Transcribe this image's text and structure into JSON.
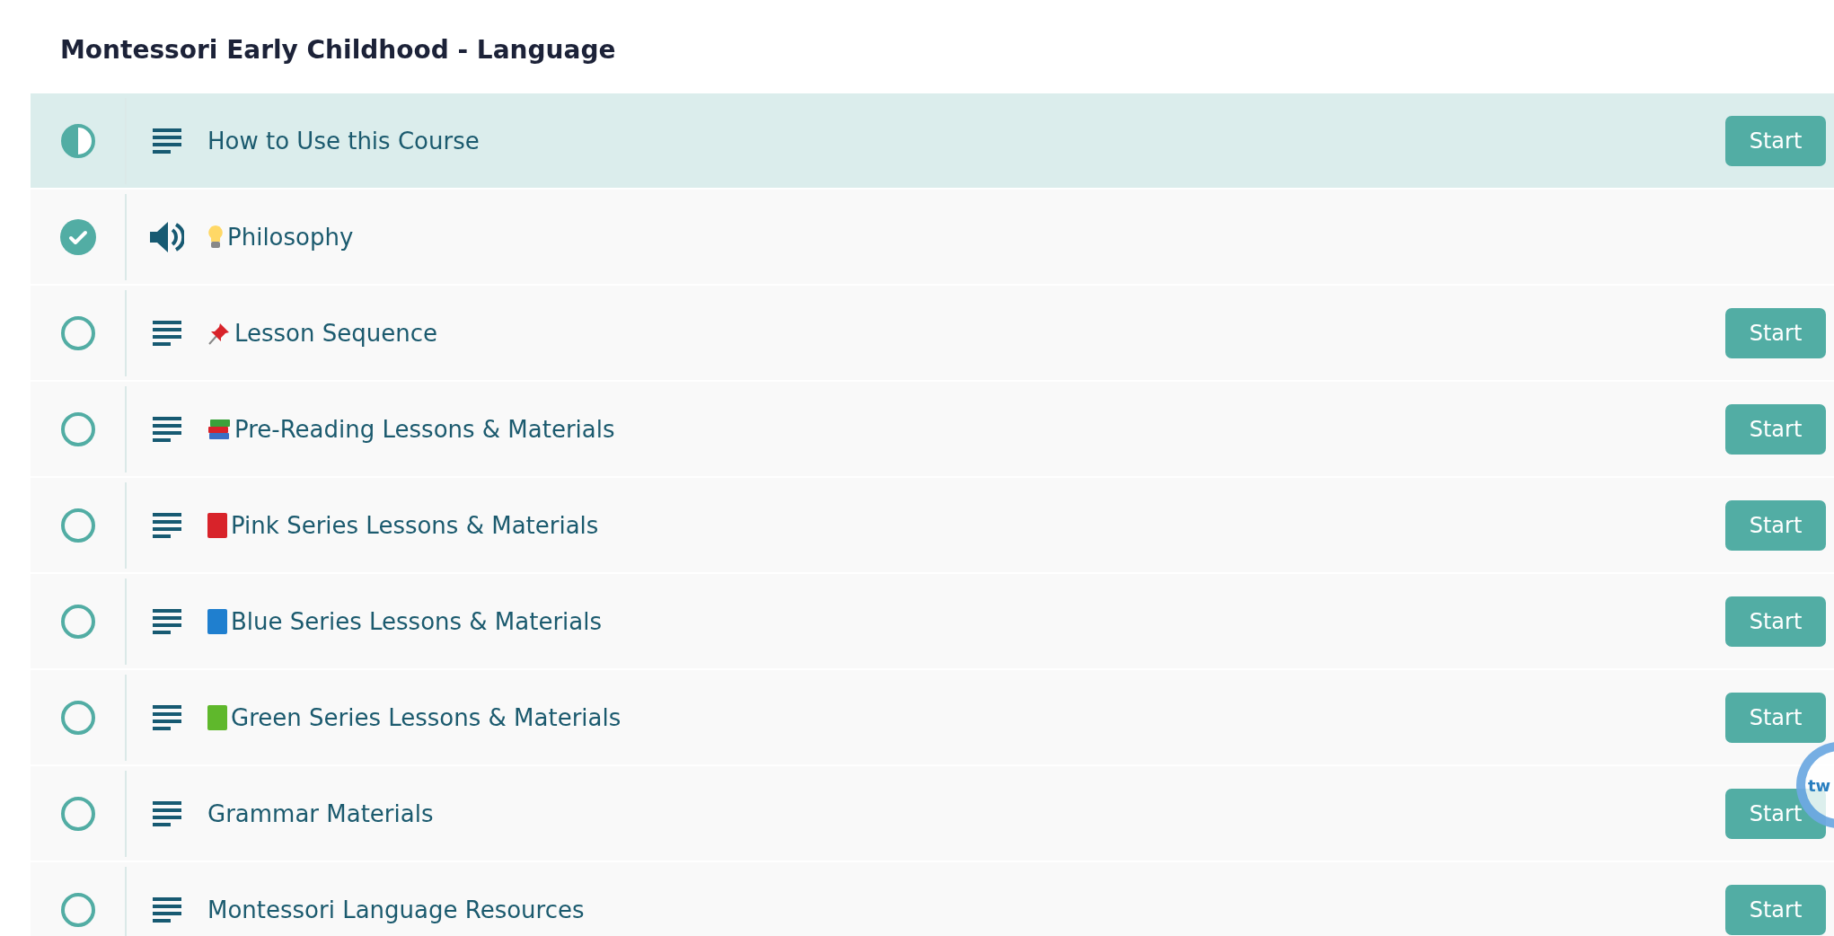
{
  "course_title": "Montessori Early Childhood - Language",
  "lessons": [
    {
      "title": "How to Use this Course",
      "level": 0.5,
      "kind": "text",
      "selected": true,
      "button": "Start"
    },
    {
      "title": "Philosophy",
      "level": 1,
      "kind": "audio",
      "selected": false,
      "emoji": {
        "kind": "bulb"
      }
    },
    {
      "title": "Lesson Sequence",
      "level": 0,
      "kind": "text",
      "selected": false,
      "emoji": {
        "kind": "pin"
      },
      "button": "Start"
    },
    {
      "title": "Pre-Reading Lessons & Materials",
      "level": 0,
      "kind": "text",
      "selected": false,
      "emoji": {
        "kind": "books"
      },
      "button": "Start"
    },
    {
      "title": "Pink Series Lessons & Materials",
      "level": 0,
      "kind": "text",
      "selected": false,
      "emoji": {
        "kind": "book",
        "color": "#d8232a"
      },
      "button": "Start"
    },
    {
      "title": "Blue Series Lessons & Materials",
      "level": 0,
      "kind": "text",
      "selected": false,
      "emoji": {
        "kind": "book",
        "color": "#1f7fcf"
      },
      "button": "Start"
    },
    {
      "title": "Green Series Lessons & Materials",
      "level": 0,
      "kind": "text",
      "selected": false,
      "emoji": {
        "kind": "book",
        "color": "#5fb82c"
      },
      "button": "Start"
    },
    {
      "title": "Grammar Materials",
      "level": 0,
      "kind": "text",
      "selected": false,
      "button": "Start"
    },
    {
      "title": "Montessori Language Resources",
      "level": 0,
      "kind": "text",
      "selected": false,
      "button": "Start"
    }
  ],
  "chat_widget": {
    "label": "tw"
  }
}
